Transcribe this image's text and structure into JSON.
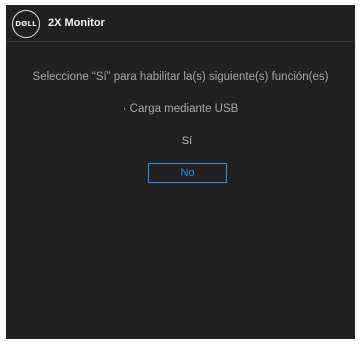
{
  "header": {
    "logo_text": "DØLL",
    "title": "2X Monitor"
  },
  "dialog": {
    "message": "Seleccione “Sí” para habilitar la(s) siguiente(s) función(es)",
    "feature": "· Carga mediante USB",
    "options": [
      {
        "label": "Sí",
        "selected": false
      },
      {
        "label": "No",
        "selected": true
      }
    ]
  },
  "colors": {
    "background": "#202020",
    "text": "#a6a6a6",
    "accent": "#2f8fe0"
  }
}
